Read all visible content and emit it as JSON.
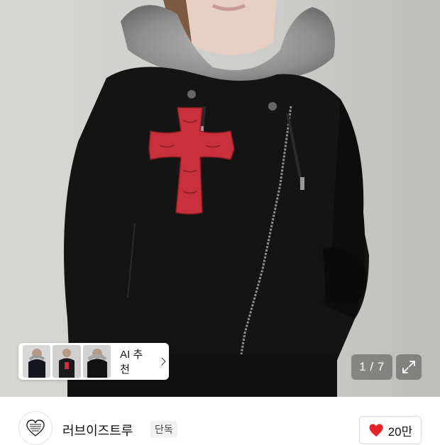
{
  "gallery": {
    "counter": "1 / 7",
    "expand_icon": "expand-icon"
  },
  "ai_recommend": {
    "label": "AI 추천",
    "thumbnails": [
      "thumbnail-1",
      "thumbnail-2",
      "thumbnail-3"
    ]
  },
  "brand": {
    "name": "러브이즈트루",
    "badge": "단독",
    "logo_icon": "heart-logo-icon"
  },
  "like": {
    "count": "20만",
    "color": "#e8202a"
  },
  "colors": {
    "cross": "#c8303c",
    "jacket": "#111111",
    "fur": "#9a9a9a"
  }
}
